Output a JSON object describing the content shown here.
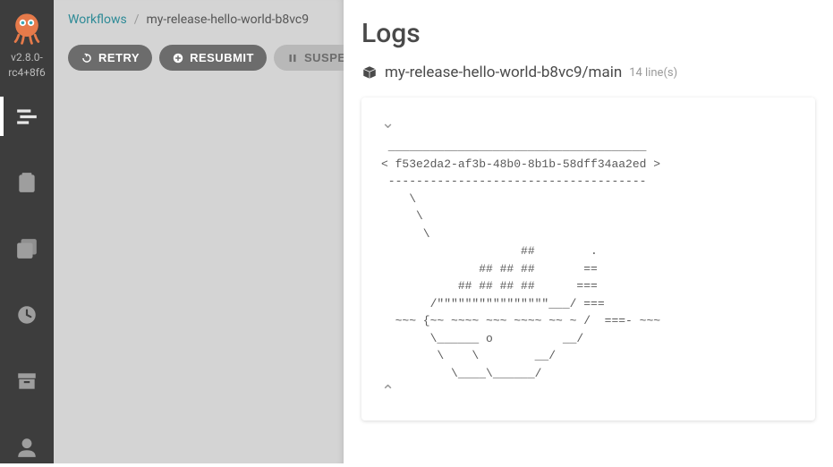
{
  "version_line1": "v2.8.0-",
  "version_line2": "rc4+8f6",
  "breadcrumb": {
    "root": "Workflows",
    "sep": "/",
    "current": "my-release-hello-world-b8vc9"
  },
  "actions": {
    "retry": "RETRY",
    "resubmit": "RESUBMIT",
    "suspend": "SUSPEND"
  },
  "logs": {
    "title": "Logs",
    "pod_path": "my-release-hello-world-b8vc9/main",
    "line_count": "14 line(s)",
    "content": " _____________________________________\n< f53e2da2-af3b-48b0-8b1b-58dff34aa2ed >\n -------------------------------------\n    \\\n     \\\n      \\\n                    ##        .\n              ## ## ##       ==\n           ## ## ## ##      ===\n       /\"\"\"\"\"\"\"\"\"\"\"\"\"\"\"\"___/ ===\n  ~~~ {~~ ~~~~ ~~~ ~~~~ ~~ ~ /  ===- ~~~\n       \\______ o          __/\n        \\    \\        __/\n          \\____\\______/"
  }
}
